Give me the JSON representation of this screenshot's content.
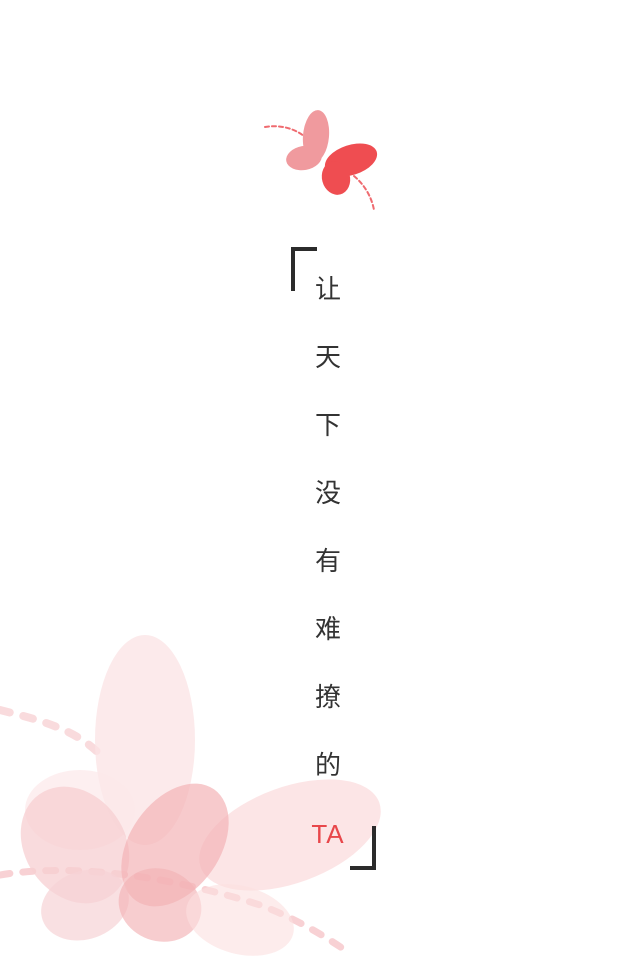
{
  "slogan": {
    "chars": [
      "让",
      "天",
      "下",
      "没",
      "有",
      "难",
      "撩",
      "的"
    ],
    "accent": "TA"
  },
  "colors": {
    "accent": "#e8474b",
    "text": "#333333",
    "bracket": "#2b2b2b",
    "logo_light": "#f09a9e",
    "logo_dark": "#ef4d51",
    "bg_butterfly": "#f6c0c3"
  },
  "icons": {
    "logo": "butterfly-icon",
    "background": "butterfly-decoration"
  }
}
